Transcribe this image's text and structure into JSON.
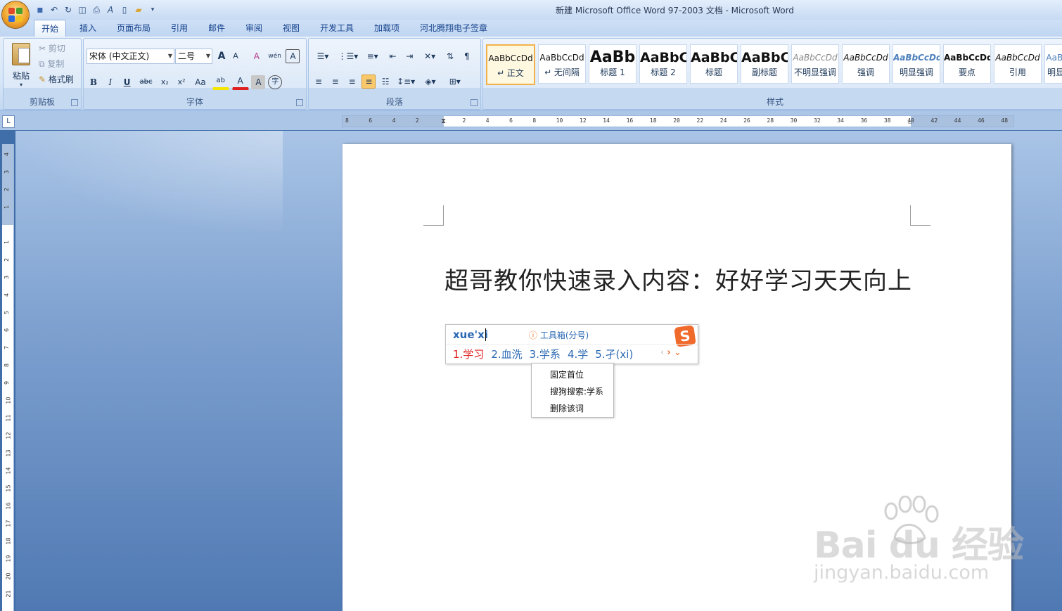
{
  "window": {
    "title": "新建 Microsoft Office Word 97-2003 文档 - Microsoft Word"
  },
  "quick_access": [
    {
      "icon": "save-icon",
      "glyph": "▪"
    },
    {
      "icon": "undo-icon",
      "glyph": "↶"
    },
    {
      "icon": "redo-icon",
      "glyph": "↻"
    },
    {
      "icon": "print-preview-icon",
      "glyph": "◫"
    },
    {
      "icon": "print-icon",
      "glyph": "⎙"
    },
    {
      "icon": "spelling-icon",
      "glyph": "A"
    },
    {
      "icon": "new-document-icon",
      "glyph": "▯"
    },
    {
      "icon": "open-icon",
      "glyph": "▰"
    },
    {
      "icon": "customize-qat-icon",
      "glyph": "▾"
    }
  ],
  "tabs": [
    "开始",
    "插入",
    "页面布局",
    "引用",
    "邮件",
    "审阅",
    "视图",
    "开发工具",
    "加载项",
    "河北腾翔电子签章"
  ],
  "ribbon": {
    "clipboard": {
      "label": "剪贴板",
      "paste": "粘贴",
      "cut": "剪切",
      "copy": "复制",
      "format_painter": "格式刷"
    },
    "font": {
      "label": "字体",
      "font_name": "宋体 (中文正文)",
      "font_size": "二号",
      "grow": "A",
      "shrink": "A",
      "clear": "A",
      "phonetic": "wén",
      "border_char": "A",
      "bold": "B",
      "italic": "I",
      "underline": "U",
      "strike": "abc",
      "subscript": "x₂",
      "superscript": "x²",
      "change_case": "Aa",
      "highlight": "ab",
      "font_color": "A",
      "char_shading": "A",
      "enclose": "字"
    },
    "paragraph": {
      "label": "段落"
    },
    "styles": {
      "label": "样式",
      "items": [
        {
          "sample": "AaBbCcDd",
          "name": "↵ 正文"
        },
        {
          "sample": "AaBbCcDd",
          "name": "↵ 无间隔"
        },
        {
          "sample": "AaBb",
          "name": "标题 1"
        },
        {
          "sample": "AaBbC",
          "name": "标题 2"
        },
        {
          "sample": "AaBbC",
          "name": "标题"
        },
        {
          "sample": "AaBbC",
          "name": "副标题"
        },
        {
          "sample": "AaBbCcDd",
          "name": "不明显强调"
        },
        {
          "sample": "AaBbCcDd",
          "name": "强调"
        },
        {
          "sample": "AaBbCcDd",
          "name": "明显强调"
        },
        {
          "sample": "AaBbCcDd",
          "name": "要点"
        },
        {
          "sample": "AaBbCcDd",
          "name": "引用"
        },
        {
          "sample": "AaBl",
          "name": "明显"
        }
      ]
    }
  },
  "ruler": {
    "corner": "L",
    "ticks": [
      "8",
      "6",
      "4",
      "2",
      "",
      "2",
      "4",
      "6",
      "8",
      "10",
      "12",
      "14",
      "16",
      "18",
      "20",
      "22",
      "24",
      "26",
      "28",
      "30",
      "32",
      "34",
      "36",
      "38",
      "40",
      "42",
      "44",
      "46",
      "48"
    ],
    "vticks": [
      "4",
      "3",
      "2",
      "1",
      "",
      "1",
      "2",
      "3",
      "4",
      "5",
      "6",
      "7",
      "8",
      "9",
      "10",
      "11",
      "12",
      "13",
      "14",
      "15",
      "16",
      "17",
      "18",
      "19",
      "20",
      "21"
    ]
  },
  "document": {
    "line1": "超哥教你快速录入内容：好好学习天天向上"
  },
  "ime": {
    "input": "xue'xi",
    "toolbox": "工具箱(分号)",
    "info_glyph": "ⓘ",
    "logo": "S",
    "candidates": [
      "1.学习",
      "2.血洗",
      "3.学系",
      "4.学",
      "5.孑(xi)"
    ],
    "nav": {
      "prev": "‹",
      "next": "›",
      "expand": "⌄"
    }
  },
  "context_menu": [
    "固定首位",
    "搜狗搜索:学系",
    "删除该词"
  ],
  "watermark": {
    "brand": "Bai du 经验",
    "url": "jingyan.baidu.com"
  }
}
